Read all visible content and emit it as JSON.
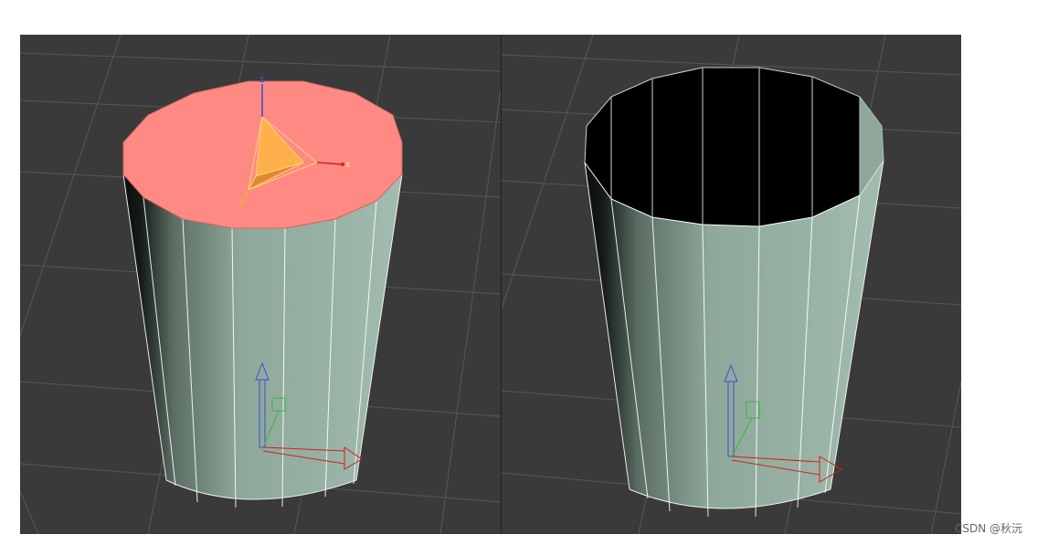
{
  "viewports": [
    {
      "id": "left",
      "state": "top face selected",
      "gizmo_axes": {
        "x": "x",
        "y": "y",
        "z": "z"
      }
    },
    {
      "id": "right",
      "state": "top face deleted (open cup)"
    }
  ],
  "colors": {
    "background": "#3a3a3a",
    "grid": "#555555",
    "body": "#8fa99b",
    "selected_face": "#ff8a84",
    "interior": "#000000",
    "gizmo_orange": "#ffb04a",
    "axis_red": "#d22020",
    "axis_green": "#39b83c",
    "axis_blue": "#3b4fd6"
  },
  "icons": [
    "move-gizmo-icon",
    "pivot-axes-icon"
  ],
  "watermark": "CSDN @秋沅"
}
